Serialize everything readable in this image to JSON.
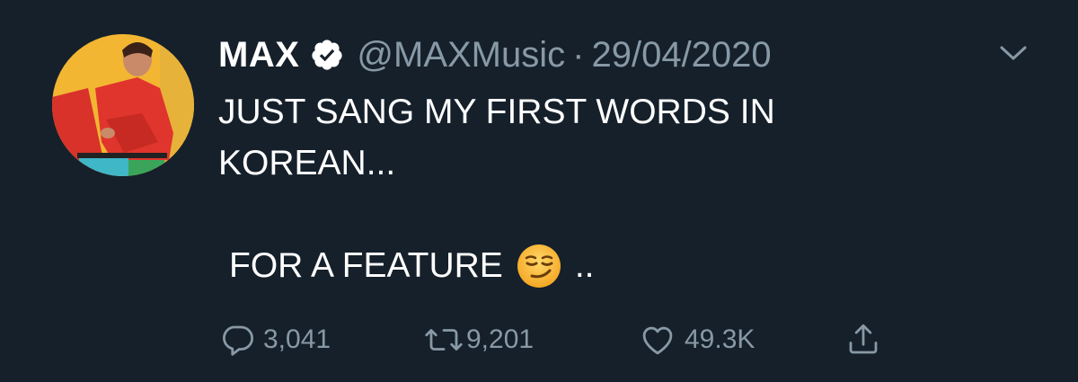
{
  "tweet": {
    "name": "MAX",
    "handle": "@MAXMusic",
    "separator": "·",
    "date": "29/04/2020",
    "text_line1": "JUST SANG MY FIRST WORDS IN",
    "text_line2": "KOREAN...",
    "text_line3": "FOR A FEATURE",
    "text_line3_tail": "..",
    "emoji": "smirking-face"
  },
  "actions": {
    "replies": "3,041",
    "retweets": "9,201",
    "likes": "49.3K"
  },
  "icons": {
    "verified": "verified-badge-icon",
    "caret": "chevron-down-icon",
    "reply": "reply-icon",
    "retweet": "retweet-icon",
    "like": "heart-icon",
    "share": "share-icon"
  },
  "colors": {
    "background": "#15202b",
    "text": "#ffffff",
    "muted": "#8899a6"
  }
}
